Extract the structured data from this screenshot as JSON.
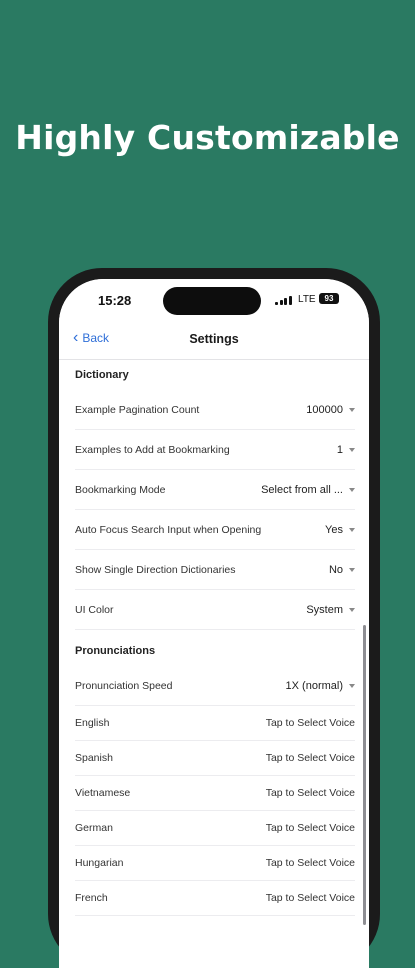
{
  "headline": "Highly Customizable",
  "status": {
    "time": "15:28",
    "network": "LTE",
    "battery": "93"
  },
  "nav": {
    "back_label": "Back",
    "title": "Settings"
  },
  "sections": {
    "dictionary": {
      "title": "Dictionary",
      "rows": [
        {
          "label": "Example Pagination Count",
          "value": "100000"
        },
        {
          "label": "Examples to Add at Bookmarking",
          "value": "1"
        },
        {
          "label": "Bookmarking Mode",
          "value": "Select from all ..."
        },
        {
          "label": "Auto Focus Search Input when Opening",
          "value": "Yes"
        },
        {
          "label": "Show Single Direction Dictionaries",
          "value": "No"
        },
        {
          "label": "UI Color",
          "value": "System"
        }
      ]
    },
    "pronunciations": {
      "title": "Pronunciations",
      "speed": {
        "label": "Pronunciation Speed",
        "value": "1X (normal)"
      },
      "voices": [
        {
          "language": "English",
          "action": "Tap to Select Voice"
        },
        {
          "language": "Spanish",
          "action": "Tap to Select Voice"
        },
        {
          "language": "Vietnamese",
          "action": "Tap to Select Voice"
        },
        {
          "language": "German",
          "action": "Tap to Select Voice"
        },
        {
          "language": "Hungarian",
          "action": "Tap to Select Voice"
        },
        {
          "language": "French",
          "action": "Tap to Select Voice"
        }
      ]
    }
  },
  "colors": {
    "background": "#2a7a62",
    "accent": "#2f6fd8",
    "phone_frame": "#1b1b1b"
  }
}
